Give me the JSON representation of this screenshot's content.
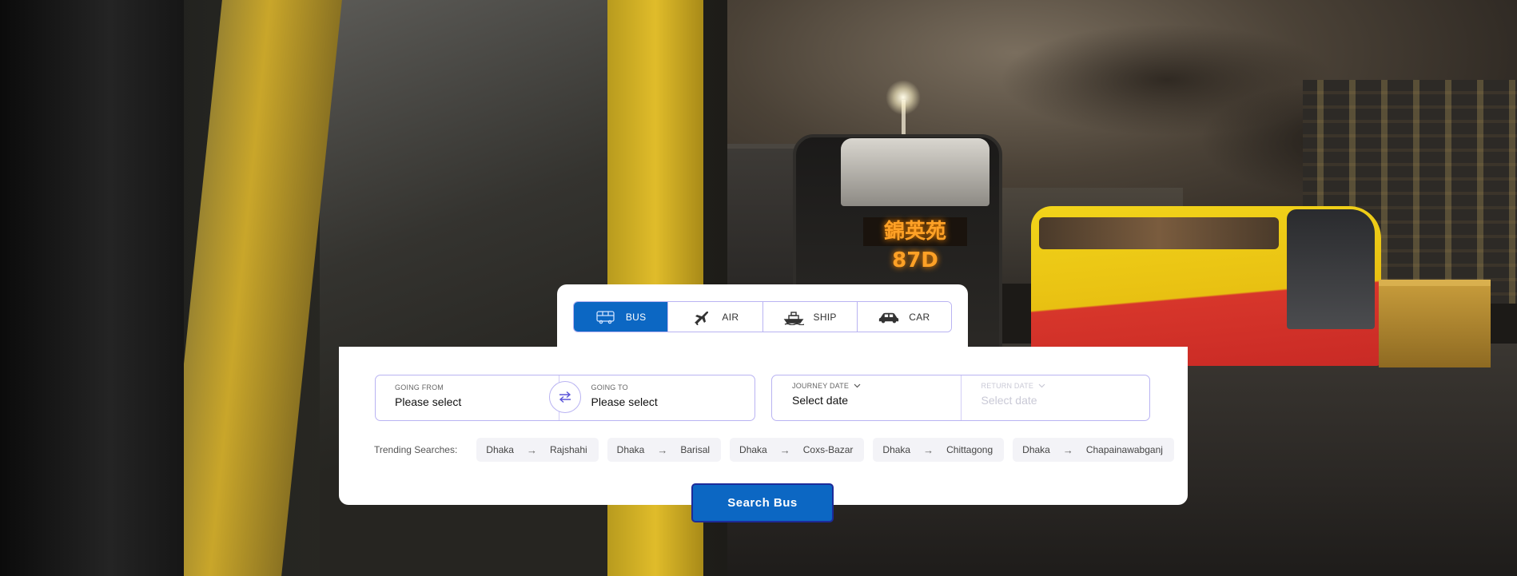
{
  "tabs": [
    {
      "label": "BUS",
      "icon": "bus-icon",
      "active": true
    },
    {
      "label": "AIR",
      "icon": "airplane-icon",
      "active": false
    },
    {
      "label": "SHIP",
      "icon": "ship-icon",
      "active": false
    },
    {
      "label": "CAR",
      "icon": "car-icon",
      "active": false
    }
  ],
  "route": {
    "from_label": "GOING FROM",
    "from_value": "Please select",
    "to_label": "GOING TO",
    "to_value": "Please select"
  },
  "dates": {
    "journey_label": "JOURNEY DATE",
    "journey_value": "Select date",
    "return_label": "RETURN DATE",
    "return_value": "Select date"
  },
  "trending": {
    "label": "Trending Searches:",
    "items": [
      {
        "from": "Dhaka",
        "to": "Rajshahi"
      },
      {
        "from": "Dhaka",
        "to": "Barisal"
      },
      {
        "from": "Dhaka",
        "to": "Coxs-Bazar"
      },
      {
        "from": "Dhaka",
        "to": "Chittagong"
      },
      {
        "from": "Dhaka",
        "to": "Chapainawabganj"
      }
    ]
  },
  "search_button": "Search Bus",
  "background": {
    "bus_sign_text": "錦英苑 87D"
  },
  "colors": {
    "accent": "#0c67c3",
    "border": "#b9b3f2"
  }
}
